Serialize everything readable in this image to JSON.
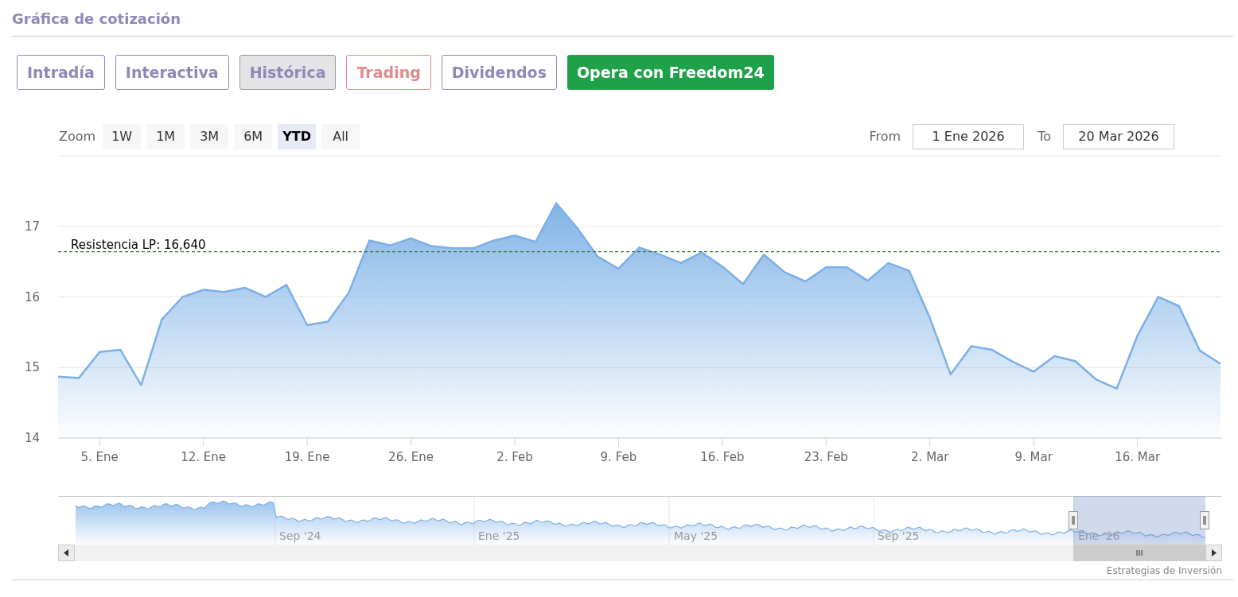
{
  "title": "Gráfica de cotización",
  "tabs": [
    {
      "label": "Intradía",
      "selected": false,
      "color": "#8f88b8"
    },
    {
      "label": "Interactiva",
      "selected": false,
      "color": "#8f88b8"
    },
    {
      "label": "Histórica",
      "selected": true,
      "color": "#8f88b8"
    },
    {
      "label": "Trading",
      "selected": false,
      "color": "#e08a8a"
    },
    {
      "label": "Dividendos",
      "selected": false,
      "color": "#8f88b8"
    }
  ],
  "cta_button": {
    "label": "Opera con Freedom24"
  },
  "zoom": {
    "label": "Zoom",
    "buttons": [
      {
        "label": "1W",
        "selected": false
      },
      {
        "label": "1M",
        "selected": false
      },
      {
        "label": "3M",
        "selected": false
      },
      {
        "label": "6M",
        "selected": false
      },
      {
        "label": "YTD",
        "selected": true
      },
      {
        "label": "All",
        "selected": false
      }
    ]
  },
  "range": {
    "from_label": "From",
    "from_value": "1 Ene 2026",
    "to_label": "To",
    "to_value": "20 Mar 2026"
  },
  "chart": {
    "chart_data": {
      "type": "area",
      "grid": true,
      "ylim": [
        14,
        18
      ],
      "yticks": [
        14,
        15,
        16,
        17
      ],
      "categories": [
        null,
        null,
        "5. Ene",
        null,
        null,
        null,
        null,
        "12. Ene",
        null,
        null,
        null,
        null,
        "19. Ene",
        null,
        null,
        null,
        null,
        "26. Ene",
        null,
        null,
        null,
        null,
        "2. Feb",
        null,
        null,
        null,
        null,
        "9. Feb",
        null,
        null,
        null,
        null,
        "16. Feb",
        null,
        null,
        null,
        null,
        "23. Feb",
        null,
        null,
        null,
        null,
        "2. Mar",
        null,
        null,
        null,
        null,
        "9. Mar",
        null,
        null,
        null,
        null,
        "16. Mar",
        null,
        null,
        null,
        null
      ],
      "series": [
        {
          "color": "#7cb0e6",
          "values": [
            14.87,
            14.85,
            15.22,
            15.25,
            14.75,
            15.68,
            16.0,
            16.1,
            16.07,
            16.13,
            16.0,
            16.17,
            15.6,
            15.65,
            16.06,
            16.8,
            16.73,
            16.83,
            16.72,
            16.69,
            16.69,
            16.8,
            16.87,
            16.78,
            17.33,
            16.98,
            16.57,
            16.4,
            16.7,
            16.6,
            16.48,
            16.63,
            16.43,
            16.18,
            16.6,
            16.35,
            16.22,
            16.42,
            16.42,
            16.23,
            16.48,
            16.37,
            15.7,
            14.9,
            15.3,
            15.25,
            15.08,
            14.94,
            15.16,
            15.09,
            14.83,
            14.7,
            15.45,
            16.0,
            15.87,
            15.24,
            15.05
          ]
        }
      ],
      "ref_lines": [
        {
          "axis": "y",
          "value": 16.64,
          "label": "Resistencia LP: 16,640",
          "color": "#2e7d32"
        }
      ]
    }
  },
  "navigator": {
    "labels": [
      "Sep '24",
      "Ene '25",
      "May '25",
      "Sep '25",
      "Ene '26"
    ]
  },
  "credit": "Estrategias de Inversión"
}
